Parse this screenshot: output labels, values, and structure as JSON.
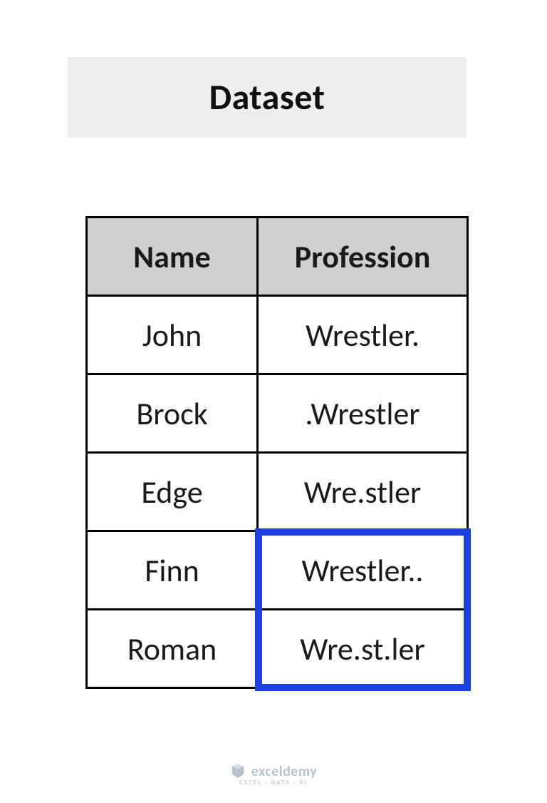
{
  "title": "Dataset",
  "headers": {
    "col1": "Name",
    "col2": "Profession"
  },
  "rows": [
    {
      "name": "John",
      "profession": "Wrestler."
    },
    {
      "name": "Brock",
      "profession": ".Wrestler"
    },
    {
      "name": "Edge",
      "profession": "Wre.stler"
    },
    {
      "name": "Finn",
      "profession": "Wrestler.."
    },
    {
      "name": "Roman",
      "profession": "Wre.st.ler"
    }
  ],
  "watermark": {
    "brand": "exceldemy",
    "tagline": "EXCEL · DATA · BI"
  },
  "highlight": {
    "visible": true
  }
}
